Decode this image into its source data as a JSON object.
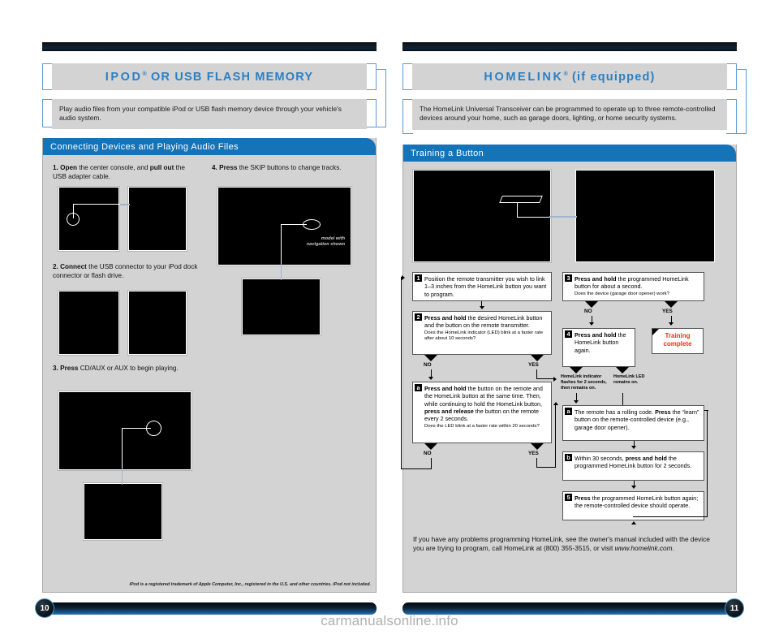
{
  "left_page": {
    "title": "IPOD",
    "title_reg": "®",
    "title_rest": " OR USB FLASH MEMORY",
    "intro": "Play audio files from your compatible iPod or USB flash memory device through your vehicle's audio system.",
    "section_header": "Connecting Devices and Playing Audio Files",
    "steps": [
      {
        "num": "1.",
        "html_parts": [
          "Open",
          " the center console, and ",
          "pull out",
          " the USB adapter cable."
        ]
      },
      {
        "num": "2.",
        "html_parts": [
          "Connect",
          " the USB connector to your iPod dock connector or flash drive."
        ]
      },
      {
        "num": "3.",
        "html_parts": [
          "Press",
          " CD/AUX or AUX to begin playing."
        ]
      },
      {
        "num": "4.",
        "html_parts": [
          "Press",
          " the SKIP buttons to change tracks."
        ]
      }
    ],
    "photo_caption": "model with\nnavigation shown",
    "footnote": "iPod is a registered trademark of Apple Computer, Inc., registered in the U.S. and other countries. iPod not included.",
    "page_number": "10"
  },
  "right_page": {
    "title": "HOMELINK",
    "title_reg": "®",
    "title_rest": " (if equipped)",
    "intro": "The HomeLink Universal Transceiver can be programmed to operate up to three remote-controlled devices around your home, such as garage doors, lighting, or home security systems.",
    "section_header": "Training a Button",
    "flow": {
      "step1": {
        "badge": "1",
        "text": "Position the remote transmitter you wish to link 1–3 inches from the HomeLink button you want to program."
      },
      "step2": {
        "badge": "2",
        "bold": "Press and hold",
        "text": " the desired HomeLink button and the button on the remote transmitter.",
        "sub": "Does the HomeLink indicator (LED) blink at a faster rate after about 10 seconds?"
      },
      "step2a": {
        "badge": "a",
        "bold1": "Press and hold",
        "text1": " the button on the remote and the HomeLink button at the same time. Then, while continuing to hold the HomeLink button, ",
        "bold2": "press and release",
        "text2": " the button on the remote every 2 seconds.",
        "sub": "Does the LED blink at a faster rate within 20 seconds?"
      },
      "step3": {
        "badge": "3",
        "bold": "Press and hold",
        "text": " the programmed HomeLink button for about a second.",
        "sub": "Does the device (garage door opener) work?"
      },
      "step4": {
        "badge": "4",
        "bold": "Press and hold",
        "text": " the HomeLink button again."
      },
      "step4a": {
        "badge": "a",
        "text1": "The remote has a rolling code. ",
        "bold": "Press",
        "text2": " the “learn” button on the remote-controlled device (e.g., garage door opener)."
      },
      "step4b": {
        "badge": "b",
        "text1": "Within 30 seconds, ",
        "bold": "press and hold",
        "text2": " the programmed HomeLink button for 2 seconds."
      },
      "step5": {
        "badge": "5",
        "bold": "Press",
        "text": " the programmed HomeLink button again; the remote-controlled device should operate."
      },
      "training_complete_line1": "Training",
      "training_complete_line2": "complete",
      "labels": {
        "no": "NO",
        "yes": "YES"
      },
      "note_left": "HomeLink indicator flashes for 2 seconds, then remains on.",
      "note_right": "HomeLink LED remains on."
    },
    "closing": {
      "part1": "If you have any problems programming HomeLink, see the owner's manual included with the device you are trying to program, call HomeLink at (800) 355-3515, or visit ",
      "url": "www.homelink.com",
      "part2": "."
    },
    "page_number": "11"
  },
  "watermark": "carmanualsonline.info",
  "colors": {
    "accent_blue": "#2b7fc4",
    "header_blue": "#1573b8",
    "panel_gray": "#d3d3d3",
    "alert_red": "#ff2a13"
  }
}
